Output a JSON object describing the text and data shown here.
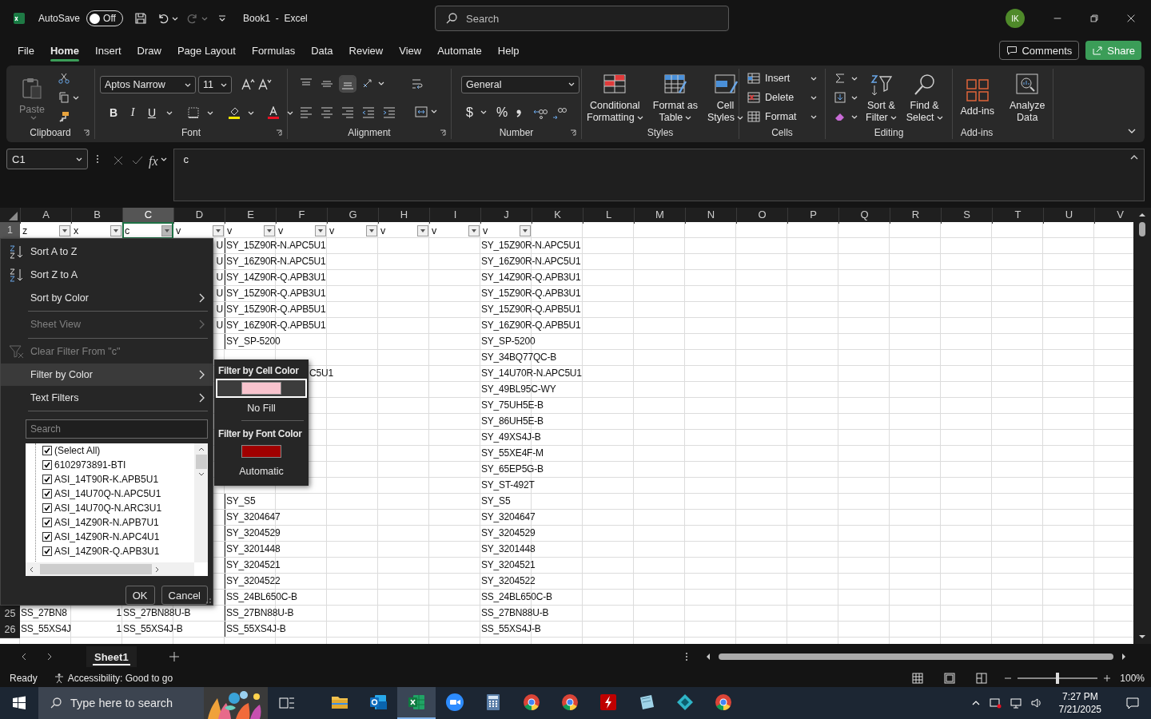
{
  "title_bar": {
    "autosave": "AutoSave",
    "autosave_toggle": {
      "label": "Off",
      "on": false
    },
    "title": "Book1  -  Excel",
    "search_placeholder": "Search",
    "avatar": "IK"
  },
  "tabs": [
    {
      "label": "File",
      "selected": false
    },
    {
      "label": "Home",
      "selected": true
    },
    {
      "label": "Insert",
      "selected": false
    },
    {
      "label": "Draw",
      "selected": false
    },
    {
      "label": "Page Layout",
      "selected": false
    },
    {
      "label": "Formulas",
      "selected": false
    },
    {
      "label": "Data",
      "selected": false
    },
    {
      "label": "Review",
      "selected": false
    },
    {
      "label": "View",
      "selected": false
    },
    {
      "label": "Automate",
      "selected": false
    },
    {
      "label": "Help",
      "selected": false
    }
  ],
  "comments": "Comments",
  "share": "Share",
  "ribbon": {
    "clipboard": {
      "label": "Clipboard",
      "paste": "Paste"
    },
    "font": {
      "label": "Font",
      "family": "Aptos Narrow",
      "size": "11",
      "bold": "B",
      "italic": "I",
      "underline": "U"
    },
    "alignment": {
      "label": "Alignment"
    },
    "number": {
      "label": "Number",
      "format": "General",
      "currency": "$",
      "percent": "%"
    },
    "styles": {
      "label": "Styles",
      "buttons": [
        {
          "kind": "conditional",
          "lines": [
            "Conditional",
            "Formatting"
          ]
        },
        {
          "kind": "table",
          "lines": [
            "Format as",
            "Table"
          ]
        },
        {
          "kind": "cell-styles",
          "lines": [
            "Cell",
            "Styles"
          ]
        }
      ]
    },
    "cells": {
      "label": "Cells",
      "buttons": [
        {
          "kind": "insert",
          "label": "Insert"
        },
        {
          "kind": "delete",
          "label": "Delete"
        },
        {
          "kind": "format",
          "label": "Format"
        }
      ]
    },
    "editing": {
      "label": "Editing",
      "buttons": [
        {
          "kind": "sort",
          "lines": [
            "Sort &",
            "Filter"
          ]
        },
        {
          "kind": "find",
          "lines": [
            "Find &",
            "Select"
          ]
        }
      ]
    },
    "addins": {
      "label": "Add-ins",
      "buttons": [
        {
          "kind": "addins",
          "lines": [
            "Add-ins"
          ]
        },
        {
          "kind": "analyze",
          "lines": [
            "Analyze",
            "Data"
          ]
        }
      ]
    }
  },
  "formula_bar": {
    "name_box": "C1",
    "fx": "fx",
    "content": "c"
  },
  "columns": [
    {
      "letter": "A",
      "selected": false
    },
    {
      "letter": "B",
      "selected": false
    },
    {
      "letter": "C",
      "selected": true
    },
    {
      "letter": "D",
      "selected": false
    },
    {
      "letter": "E",
      "selected": false
    },
    {
      "letter": "F",
      "selected": false
    },
    {
      "letter": "G",
      "selected": false
    },
    {
      "letter": "H",
      "selected": false
    },
    {
      "letter": "I",
      "selected": false
    },
    {
      "letter": "J",
      "selected": false
    },
    {
      "letter": "K",
      "selected": false
    },
    {
      "letter": "L",
      "selected": false
    },
    {
      "letter": "M",
      "selected": false
    },
    {
      "letter": "N",
      "selected": false
    },
    {
      "letter": "O",
      "selected": false
    },
    {
      "letter": "P",
      "selected": false
    },
    {
      "letter": "Q",
      "selected": false
    },
    {
      "letter": "R",
      "selected": false
    },
    {
      "letter": "S",
      "selected": false
    },
    {
      "letter": "T",
      "selected": false
    },
    {
      "letter": "U",
      "selected": false
    },
    {
      "letter": "V",
      "selected": false
    }
  ],
  "filter_row": {
    "number": "1",
    "cells": [
      {
        "text": "z",
        "open": false,
        "selected": false
      },
      {
        "text": "x",
        "open": false,
        "selected": false
      },
      {
        "text": "c",
        "open": true,
        "selected": true
      },
      {
        "text": "v",
        "open": false,
        "selected": false
      },
      {
        "text": "v",
        "open": false,
        "selected": false
      },
      {
        "text": "v",
        "open": false,
        "selected": false
      },
      {
        "text": "v",
        "open": false,
        "selected": false
      },
      {
        "text": "v",
        "open": false,
        "selected": false
      },
      {
        "text": "v",
        "open": false,
        "selected": false
      },
      {
        "text": "v",
        "open": false,
        "selected": false
      }
    ]
  },
  "rows": [
    {
      "cells": {
        "D": {
          "text": "U",
          "kind": "clipped"
        },
        "E": {
          "text": "SY_15Z90R-N.APC5U1"
        },
        "J": {
          "text": "SY_15Z90R-N.APC5U1"
        }
      }
    },
    {
      "cells": {
        "D": {
          "text": "U",
          "kind": "clipped"
        },
        "E": {
          "text": "SY_16Z90R-N.APC5U1"
        },
        "J": {
          "text": "SY_16Z90R-N.APC5U1"
        }
      }
    },
    {
      "cells": {
        "D": {
          "text": "U",
          "kind": "clipped"
        },
        "E": {
          "text": "SY_14Z90R-Q.APB3U1"
        },
        "J": {
          "text": "SY_14Z90R-Q.APB3U1"
        }
      }
    },
    {
      "cells": {
        "D": {
          "text": "U",
          "kind": "clipped"
        },
        "E": {
          "text": "SY_15Z90R-Q.APB3U1"
        },
        "J": {
          "text": "SY_15Z90R-Q.APB3U1"
        }
      }
    },
    {
      "cells": {
        "D": {
          "text": "U",
          "kind": "clipped"
        },
        "E": {
          "text": "SY_15Z90R-Q.APB5U1"
        },
        "J": {
          "text": "SY_15Z90R-Q.APB5U1"
        }
      }
    },
    {
      "cells": {
        "D": {
          "text": "U",
          "kind": "clipped"
        },
        "E": {
          "text": "SY_16Z90R-Q.APB5U1"
        },
        "J": {
          "text": "SY_16Z90R-Q.APB5U1"
        }
      }
    },
    {
      "cells": {
        "E": {
          "text": "SY_SP-5200"
        },
        "J": {
          "text": "SY_SP-5200"
        }
      }
    },
    {
      "cells": {
        "J": {
          "text": "SY_34BQ77QC-B"
        }
      }
    },
    {
      "cells": {
        "F": {
          "text": "C5U1",
          "kind": "tail"
        },
        "J": {
          "text": "SY_14U70R-N.APC5U1"
        }
      }
    },
    {
      "cells": {
        "J": {
          "text": "SY_49BL95C-WY"
        }
      }
    },
    {
      "cells": {
        "J": {
          "text": "SY_75UH5E-B"
        }
      }
    },
    {
      "cells": {
        "J": {
          "text": "SY_86UH5E-B"
        }
      }
    },
    {
      "cells": {
        "J": {
          "text": "SY_49XS4J-B"
        }
      }
    },
    {
      "cells": {
        "J": {
          "text": "SY_55XE4F-M"
        }
      }
    },
    {
      "cells": {
        "J": {
          "text": "SY_65EP5G-B"
        }
      }
    },
    {
      "cells": {
        "J": {
          "text": "SY_ST-492T"
        }
      }
    },
    {
      "cells": {
        "E": {
          "text": "SY_S5"
        },
        "J": {
          "text": "SY_S5"
        }
      }
    },
    {
      "cells": {
        "E": {
          "text": "SY_3204647"
        },
        "J": {
          "text": "SY_3204647"
        }
      }
    },
    {
      "cells": {
        "E": {
          "text": "SY_3204529"
        },
        "J": {
          "text": "SY_3204529"
        }
      }
    },
    {
      "cells": {
        "E": {
          "text": "SY_3201448"
        },
        "J": {
          "text": "SY_3201448"
        }
      }
    },
    {
      "cells": {
        "E": {
          "text": "SY_3204521"
        },
        "J": {
          "text": "SY_3204521"
        }
      }
    },
    {
      "cells": {
        "E": {
          "text": "SY_3204522"
        },
        "J": {
          "text": "SY_3204522"
        }
      }
    },
    {
      "cells": {
        "E": {
          "text": "SS_24BL650C-B"
        },
        "J": {
          "text": "SS_24BL650C-B"
        }
      }
    },
    {
      "number": "25",
      "cells": {
        "A": {
          "text": "SS_27BN8"
        },
        "B": {
          "text": "1",
          "kind": "number"
        },
        "C": {
          "text": "SS_27BN88U-B"
        },
        "E": {
          "text": "SS_27BN88U-B"
        },
        "J": {
          "text": "SS_27BN88U-B"
        }
      }
    },
    {
      "number": "26",
      "cells": {
        "A": {
          "text": "SS_55XS4J"
        },
        "B": {
          "text": "1",
          "kind": "number"
        },
        "C": {
          "text": "SS_55XS4J-B"
        },
        "E": {
          "text": "SS_55XS4J-B"
        },
        "J": {
          "text": "SS_55XS4J-B"
        }
      }
    }
  ],
  "filter_menu": {
    "items": [
      {
        "label": "Sort A to Z",
        "kind": "sort-asc",
        "submenu": false,
        "disabled": false,
        "selected": false,
        "divider_above": false
      },
      {
        "label": "Sort Z to A",
        "kind": "sort-desc",
        "submenu": false,
        "disabled": false,
        "selected": false,
        "divider_above": false
      },
      {
        "label": "Sort by Color",
        "kind": "plain",
        "submenu": true,
        "disabled": false,
        "selected": false,
        "divider_above": false
      },
      {
        "label": "Sheet View",
        "kind": "plain",
        "submenu": true,
        "disabled": true,
        "selected": false,
        "divider_above": true
      },
      {
        "label": "Clear Filter From \"c\"",
        "kind": "clear-filter",
        "submenu": false,
        "disabled": true,
        "selected": false,
        "divider_above": true
      },
      {
        "label": "Filter by Color",
        "kind": "plain",
        "submenu": true,
        "disabled": false,
        "selected": true,
        "divider_above": false
      },
      {
        "label": "Text Filters",
        "kind": "plain",
        "submenu": true,
        "disabled": false,
        "selected": false,
        "divider_above": false
      }
    ],
    "search_placeholder": "Search",
    "values": [
      {
        "label": "(Select All)",
        "checked": true
      },
      {
        "label": "6102973891-BTI",
        "checked": true
      },
      {
        "label": "ASI_14T90R-K.APB5U1",
        "checked": true
      },
      {
        "label": "ASI_14U70Q-N.APC5U1",
        "checked": true
      },
      {
        "label": "ASI_14U70Q-N.ARC3U1",
        "checked": true
      },
      {
        "label": "ASI_14Z90R-N.APB7U1",
        "checked": true
      },
      {
        "label": "ASI_14Z90R-N.APC4U1",
        "checked": true
      },
      {
        "label": "ASI_14Z90R-Q.APB3U1",
        "checked": true
      }
    ],
    "ok": "OK",
    "cancel": "Cancel"
  },
  "color_menu": {
    "cell_heading": "Filter by Cell Color",
    "cell_colors": [
      {
        "color": "#f8c3cd",
        "selected": true
      }
    ],
    "no_fill": "No Fill",
    "font_heading": "Filter by Font Color",
    "font_colors": [
      {
        "color": "#a00000",
        "selected": false
      }
    ],
    "automatic": "Automatic"
  },
  "sheet_tabs": [
    {
      "label": "Sheet1",
      "selected": true
    }
  ],
  "status_bar": {
    "ready": "Ready",
    "accessibility": "Accessibility: Good to go",
    "zoom": "100%",
    "zoom_slider": {
      "level": 0.5
    }
  },
  "taskbar": {
    "search_placeholder": "Type here to search",
    "apps": [
      {
        "kind": "folder",
        "active": false
      },
      {
        "kind": "mail",
        "active": false
      },
      {
        "kind": "spreadsheet",
        "active": true
      },
      {
        "kind": "video",
        "active": false
      },
      {
        "kind": "calculator",
        "active": false
      },
      {
        "kind": "browser",
        "active": false
      },
      {
        "kind": "browser",
        "active": false
      },
      {
        "kind": "transfer",
        "active": false
      },
      {
        "kind": "notes",
        "active": false
      },
      {
        "kind": "diamond",
        "active": false
      },
      {
        "kind": "browser",
        "active": false
      }
    ],
    "time": "7:27 PM",
    "date": "7/21/2025"
  }
}
